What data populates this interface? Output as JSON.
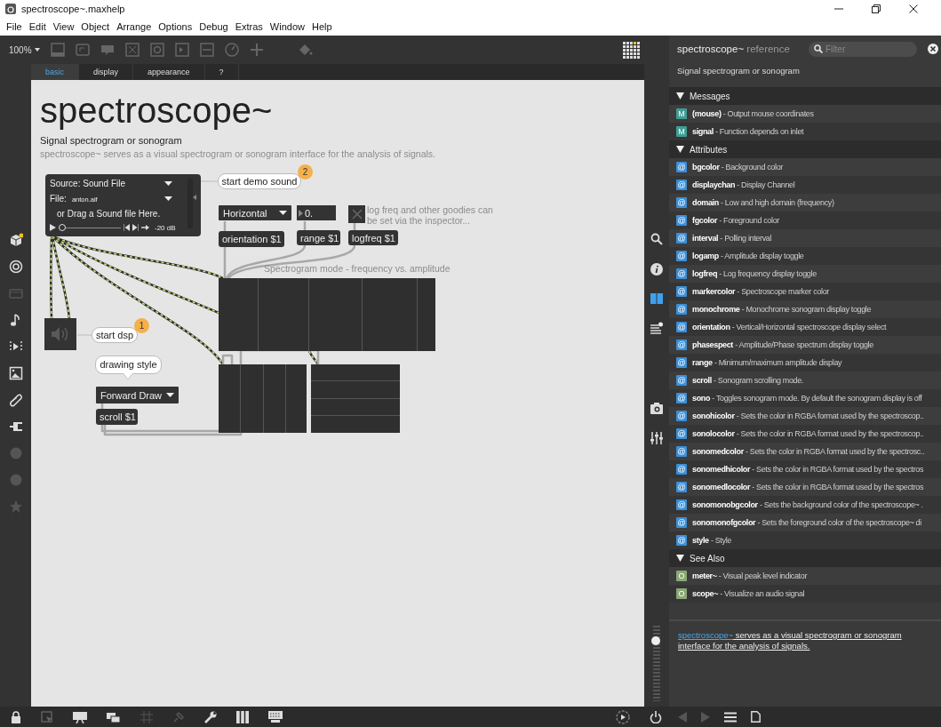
{
  "window": {
    "title": "spectroscope~.maxhelp"
  },
  "menu": [
    "File",
    "Edit",
    "View",
    "Object",
    "Arrange",
    "Options",
    "Debug",
    "Extras",
    "Window",
    "Help"
  ],
  "toolbar": {
    "zoom": "100%"
  },
  "tabs": [
    {
      "label": "basic",
      "selected": true
    },
    {
      "label": "display",
      "selected": false
    },
    {
      "label": "appearance",
      "selected": false
    },
    {
      "label": "?",
      "selected": false
    }
  ],
  "patch": {
    "title": "spectroscope~",
    "subtitle": "Signal spectrogram or sonogram",
    "description": "spectroscope~ serves as a visual spectrogram or sonogram interface for the analysis of signals.",
    "objects": [
      {
        "kind": "playlist",
        "source": "Source: Sound File",
        "file_label": "File:",
        "file": "anton.aif",
        "hint": "or Drag a Sound file Here.",
        "level": 0,
        "gain": "-20 dB"
      },
      {
        "kind": "bubble",
        "text": "start demo sound",
        "step": "2"
      },
      {
        "kind": "menu",
        "text": "Horizontal"
      },
      {
        "kind": "number",
        "value": "0."
      },
      {
        "kind": "toggle",
        "checked": false
      },
      {
        "kind": "comment",
        "text": "log freq and other goodies can\nbe set via the inspector..."
      },
      {
        "kind": "message",
        "text": "orientation $1"
      },
      {
        "kind": "message",
        "text": "range $1"
      },
      {
        "kind": "message",
        "text": "logfreq $1"
      },
      {
        "kind": "comment",
        "text": "Spectrogram mode - frequency vs. amplitude"
      },
      {
        "kind": "scope"
      },
      {
        "kind": "dac",
        "on": false
      },
      {
        "kind": "bubble",
        "text": "start dsp",
        "step": "1"
      },
      {
        "kind": "callout",
        "text": "drawing style"
      },
      {
        "kind": "menu",
        "text": "Forward Draw"
      },
      {
        "kind": "message",
        "text": "scroll $1"
      },
      {
        "kind": "scope"
      },
      {
        "kind": "scope"
      }
    ]
  },
  "reference": {
    "title": "spectroscope~",
    "title_suffix": "reference",
    "filter_placeholder": "Filter",
    "summary": "Signal spectrogram or sonogram",
    "sections": [
      {
        "title": "Messages",
        "expanded": true,
        "items": [
          {
            "kind": "message",
            "tag": "M",
            "text": "**(mouse)** - Output mouse coordinates"
          },
          {
            "kind": "message",
            "tag": "M",
            "text": "**signal** - Function depends on inlet"
          }
        ]
      },
      {
        "title": "Attributes",
        "expanded": true,
        "items": [
          {
            "kind": "attribute",
            "tag": "@",
            "text": "**bgcolor** - Background color"
          },
          {
            "kind": "attribute",
            "tag": "@",
            "text": "**displaychan** - Display Channel"
          },
          {
            "kind": "attribute",
            "tag": "@",
            "text": "**domain** - Low and high domain (frequency)"
          },
          {
            "kind": "attribute",
            "tag": "@",
            "text": "**fgcolor** - Foreground color"
          },
          {
            "kind": "attribute",
            "tag": "@",
            "text": "**interval** - Polling interval"
          },
          {
            "kind": "attribute",
            "tag": "@",
            "text": "**logamp** - Amplitude display toggle"
          },
          {
            "kind": "attribute",
            "tag": "@",
            "text": "**logfreq** - Log frequency display toggle"
          },
          {
            "kind": "attribute",
            "tag": "@",
            "text": "**markercolor** - Spectroscope marker color"
          },
          {
            "kind": "attribute",
            "tag": "@",
            "text": "**monochrome** - Monochrome sonogram display toggle"
          },
          {
            "kind": "attribute",
            "tag": "@",
            "text": "**orientation** - Vertical/Horizontal spectroscope display select"
          },
          {
            "kind": "attribute",
            "tag": "@",
            "text": "**phasespect** - Amplitude/Phase spectrum display toggle"
          },
          {
            "kind": "attribute",
            "tag": "@",
            "text": "**range** - Minimum/maximum amplitude display"
          },
          {
            "kind": "attribute",
            "tag": "@",
            "text": "**scroll** - Sonogram scrolling mode."
          },
          {
            "kind": "attribute",
            "tag": "@",
            "text": "**sono** - Toggles sonogram mode. By default the sonogram display is off"
          },
          {
            "kind": "attribute",
            "tag": "@",
            "text": "**sonohicolor** - Sets the color in RGBA format used by the spectroscop.."
          },
          {
            "kind": "attribute",
            "tag": "@",
            "text": "**sonolocolor** - Sets the color in RGBA format used by the spectroscop.."
          },
          {
            "kind": "attribute",
            "tag": "@",
            "text": "**sonomedcolor** - Sets the color in RGBA format used by the spectrosc.."
          },
          {
            "kind": "attribute",
            "tag": "@",
            "text": "**sonomedhicolor** - Sets the color in RGBA format used by the spectros"
          },
          {
            "kind": "attribute",
            "tag": "@",
            "text": "**sonomedlocolor** - Sets the color in RGBA format used by the spectros"
          },
          {
            "kind": "attribute",
            "tag": "@",
            "text": "**sonomonobgcolor** - Sets the background color of the spectroscope~ ."
          },
          {
            "kind": "attribute",
            "tag": "@",
            "text": "**sonomonofgcolor** - Sets the foreground color of the spectroscope~ di"
          },
          {
            "kind": "attribute",
            "tag": "@",
            "text": "**style** - Style"
          }
        ]
      },
      {
        "title": "See Also",
        "expanded": true,
        "items": [
          {
            "kind": "object",
            "tag": "O",
            "text": "**meter~** - Visual peak level indicator"
          },
          {
            "kind": "object",
            "tag": "O",
            "text": "**scope~** - Visualize an audio signal"
          }
        ]
      }
    ],
    "footer": {
      "link": "spectroscope~",
      "text": "serves as a visual spectrogram or sonogram interface for the analysis of signals."
    }
  },
  "output_gain": {
    "level": 0.8
  }
}
